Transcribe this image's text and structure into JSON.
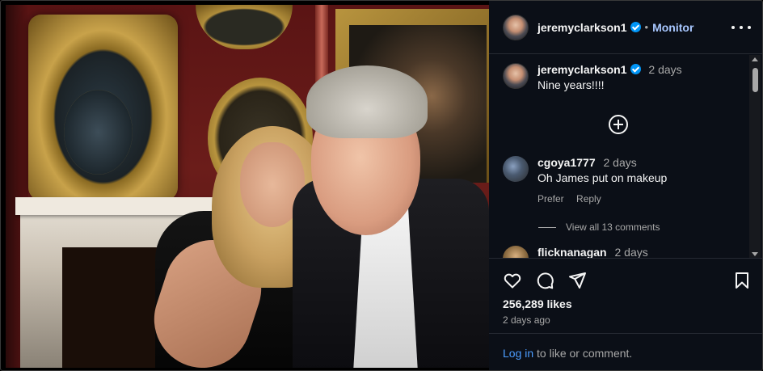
{
  "post": {
    "author": "jeremyclarkson1",
    "follow_label": "Monitor",
    "separator": "•",
    "caption": {
      "username": "jeremyclarkson1",
      "time": "2 days",
      "text": "Nine years!!!!"
    },
    "comments": [
      {
        "username": "cgoya1777",
        "time": "2 days",
        "text": "Oh James put on makeup",
        "actions": [
          "Prefer",
          "Reply"
        ]
      },
      {
        "username": "flicknanagan",
        "time": "2 days"
      }
    ],
    "view_all": "View all 13 comments",
    "likes": "256,289 likes",
    "posted_ago": "2 days ago",
    "login_prompt": {
      "link": "Log in",
      "text": " to like or comment."
    }
  },
  "icons": {
    "like": "heart-icon",
    "comment": "comment-icon",
    "share": "send-icon",
    "save": "bookmark-icon",
    "add": "plus-circle-icon",
    "more": "more-options-icon",
    "verified": "verified-badge-icon"
  },
  "colors": {
    "panel_bg": "#0b0f17",
    "accent_link": "#4c9dff",
    "follow": "#a8c7ff",
    "verified": "#0095f6",
    "muted": "#a8a8a8"
  }
}
